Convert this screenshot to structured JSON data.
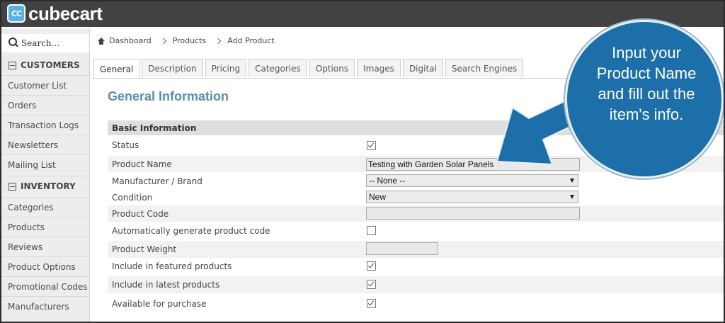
{
  "app": {
    "logo_badge": "CC",
    "logo_text": "cubecart"
  },
  "sidebar": {
    "search_placeholder": "Search…",
    "sections": [
      {
        "label": "CUSTOMERS",
        "items": [
          "Customer List",
          "Orders",
          "Transaction Logs",
          "Newsletters",
          "Mailing List"
        ]
      },
      {
        "label": "INVENTORY",
        "items": [
          "Categories",
          "Products",
          "Reviews",
          "Product Options",
          "Promotional Codes",
          "Manufacturers"
        ]
      }
    ]
  },
  "breadcrumb": [
    "Dashboard",
    "Products",
    "Add Product"
  ],
  "tabs": [
    "General",
    "Description",
    "Pricing",
    "Categories",
    "Options",
    "Images",
    "Digital",
    "Search Engines"
  ],
  "active_tab": "General",
  "page": {
    "heading": "General Information",
    "section_title": "Basic Information",
    "fields": {
      "status": {
        "label": "Status",
        "checked": true
      },
      "product_name": {
        "label": "Product Name",
        "value": "Testing with Garden Solar Panels"
      },
      "manufacturer": {
        "label": "Manufacturer / Brand",
        "selected": "-- None --"
      },
      "condition": {
        "label": "Condition",
        "selected": "New"
      },
      "product_code": {
        "label": "Product Code",
        "value": ""
      },
      "auto_code": {
        "label": "Automatically generate product code",
        "checked": false
      },
      "weight": {
        "label": "Product Weight",
        "value": ""
      },
      "featured": {
        "label": "Include in featured products",
        "checked": true
      },
      "latest": {
        "label": "Include in latest products",
        "checked": true
      },
      "available": {
        "label": "Available for purchase",
        "checked": true
      }
    }
  },
  "callout": {
    "text_lines": [
      "Input your",
      "Product Name",
      "and fill out the",
      "item's info."
    ],
    "color": "#1c6fa8"
  },
  "colors": {
    "topbar": "#424242",
    "heading": "#5a8ea7",
    "logo_badge": "#5bb0e4"
  }
}
